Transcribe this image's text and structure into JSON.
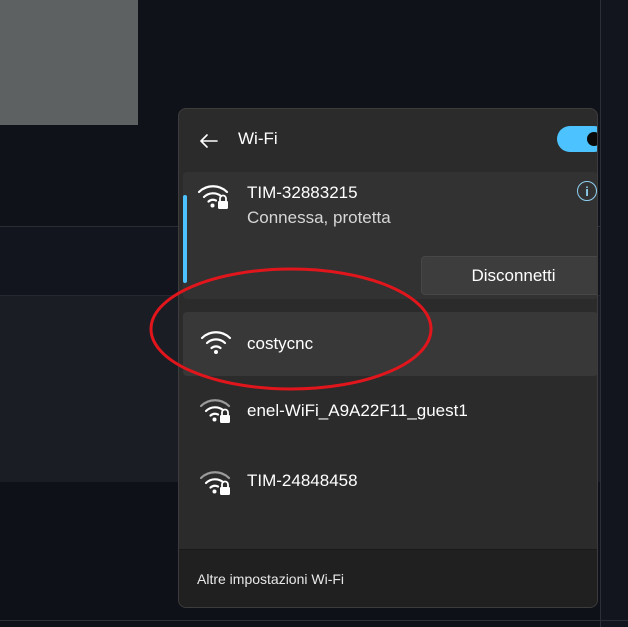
{
  "wifi_panel": {
    "title": "Wi-Fi",
    "toggle_on": true,
    "accent_color": "#4cc2ff",
    "connected": {
      "name": "TIM-32883215",
      "status": "Connessa, protetta",
      "secured": true,
      "info_icon": "info-icon",
      "disconnect_label": "Disconnetti"
    },
    "networks": [
      {
        "name": "costycnc",
        "secured": false
      },
      {
        "name": "enel-WiFi_A9A22F11_guest1",
        "secured": true
      },
      {
        "name": "TIM-24848458",
        "secured": true
      }
    ],
    "footer_link": "Altre impostazioni Wi-Fi"
  },
  "annotation": {
    "shape": "ellipse",
    "color": "#e0161c"
  }
}
